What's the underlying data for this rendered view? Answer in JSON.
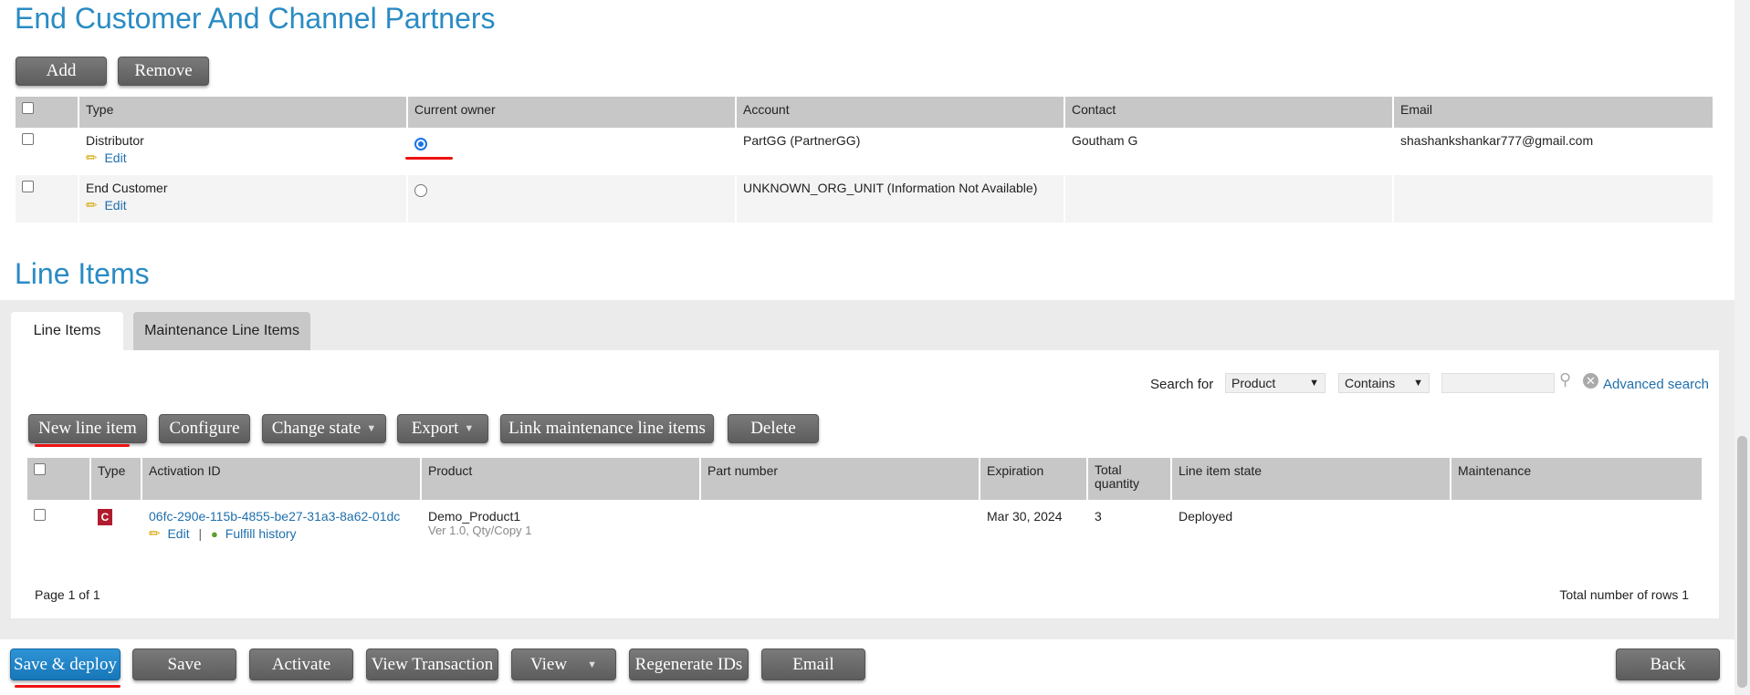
{
  "partners": {
    "title": "End Customer And Channel Partners",
    "add_label": "Add",
    "remove_label": "Remove",
    "columns": [
      "Type",
      "Current owner",
      "Account",
      "Contact",
      "Email"
    ],
    "rows": [
      {
        "type": "Distributor",
        "edit": "Edit",
        "account": "PartGG (PartnerGG)",
        "contact": "Goutham G",
        "email": "shashankshankar777@gmail.com"
      },
      {
        "type": "End Customer",
        "edit": "Edit",
        "account": "UNKNOWN_ORG_UNIT (Information Not Available)",
        "contact": "",
        "email": ""
      }
    ]
  },
  "line_items": {
    "title": "Line Items",
    "tabs": [
      "Line Items",
      "Maintenance Line Items"
    ],
    "search": {
      "label": "Search for",
      "field": "Product",
      "operator": "Contains",
      "value": "",
      "advanced": "Advanced search"
    },
    "toolbar": {
      "new": "New line item",
      "configure": "Configure",
      "change_state": "Change state",
      "export": "Export",
      "link_maint": "Link maintenance line items",
      "delete": "Delete"
    },
    "columns": [
      "Type",
      "Activation ID",
      "Product",
      "Part number",
      "Expiration",
      "Total quantity",
      "Line item state",
      "Maintenance"
    ],
    "rows": [
      {
        "type_icon": "C",
        "activation_id": "06fc-290e-115b-4855-be27-31a3-8a62-01dc",
        "edit": "Edit",
        "sep": "|",
        "fulfill": "Fulfill history",
        "product": "Demo_Product1",
        "product_sub": "Ver 1.0, Qty/Copy 1",
        "part_number": "",
        "expiration": "Mar 30, 2024",
        "quantity": "3",
        "state": "Deployed",
        "maintenance": ""
      }
    ],
    "page_info": "Page 1 of 1",
    "total_rows": "Total number of rows 1"
  },
  "footer": {
    "save_deploy": "Save & deploy",
    "save": "Save",
    "activate": "Activate",
    "view_transaction": "View Transaction",
    "view": "View",
    "regenerate": "Regenerate IDs",
    "email": "Email",
    "back": "Back"
  },
  "colors": {
    "accent": "#2a8bc4",
    "highlight": "#e11111"
  }
}
